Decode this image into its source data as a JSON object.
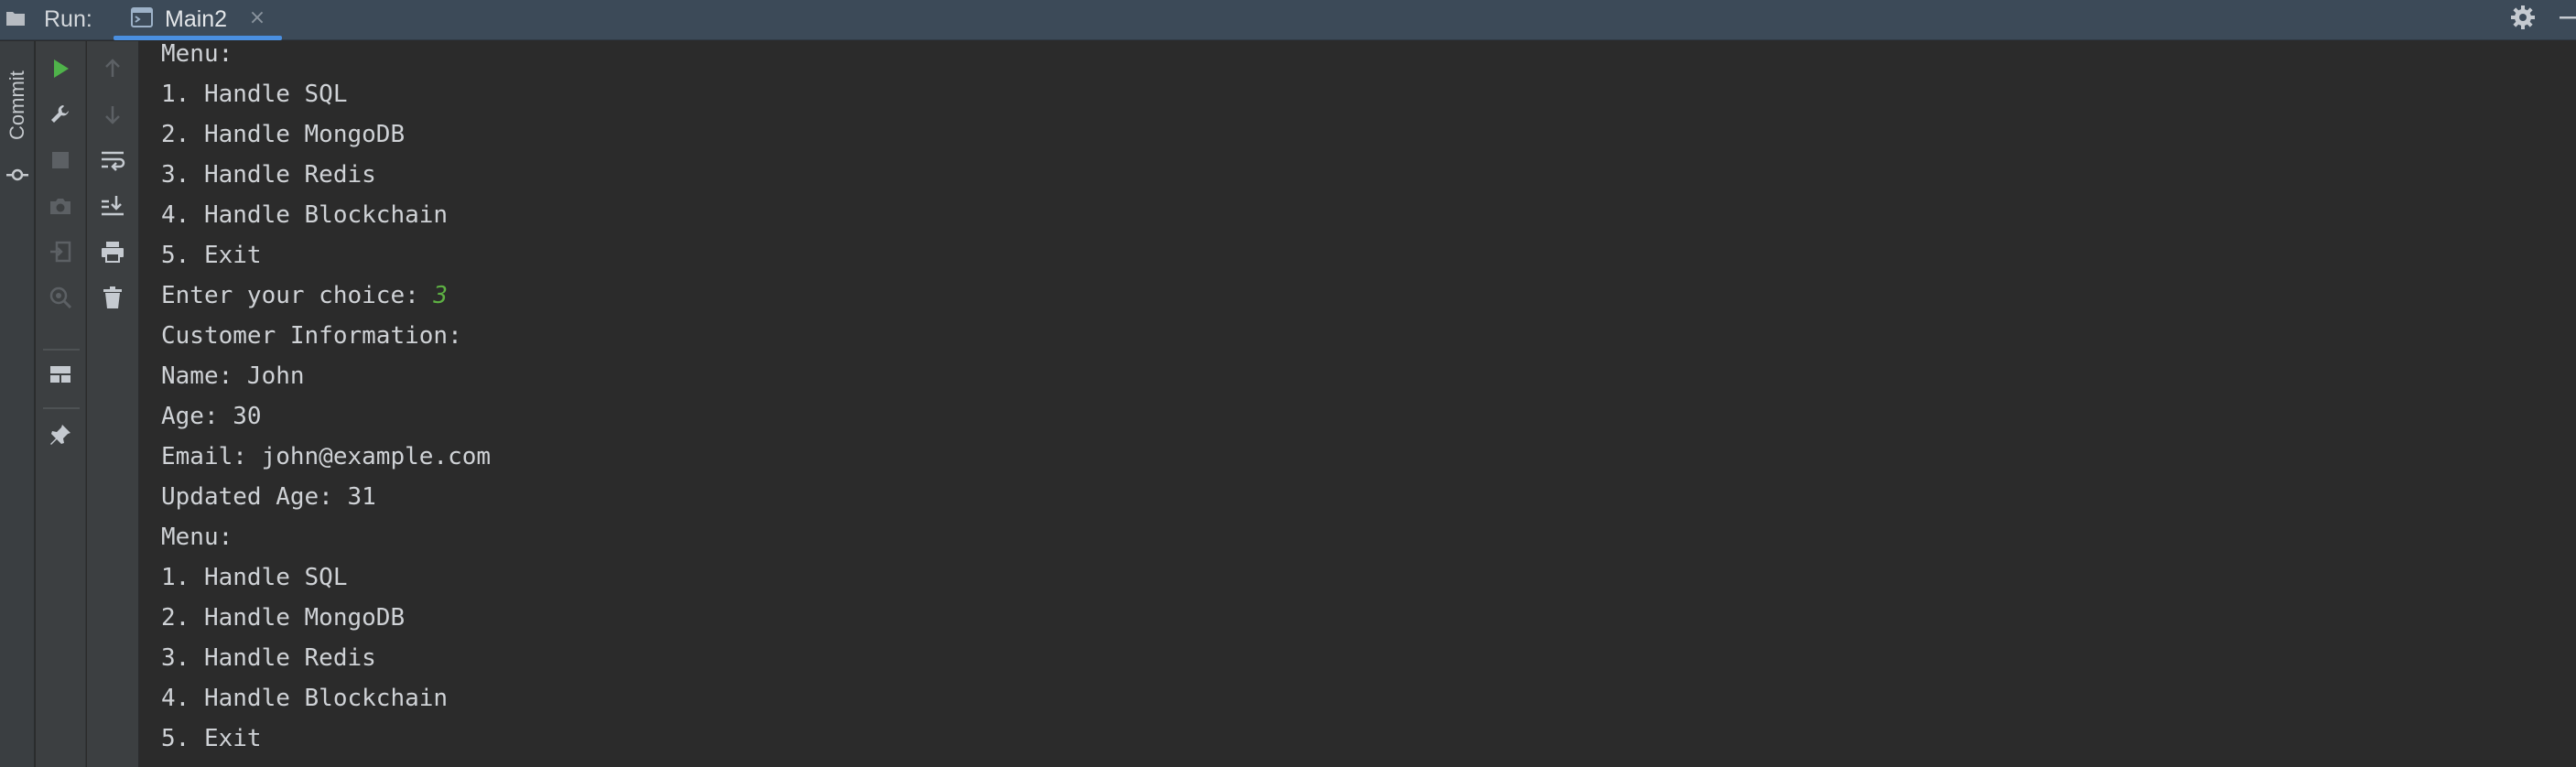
{
  "header": {
    "run_label": "Run:",
    "tab_label": "Main2",
    "tab_close_glyph": "×",
    "accent_color": "#4a8fe0"
  },
  "left_strip": {
    "commit_label": "Commit"
  },
  "toolbar": {
    "column_one": [
      "run-icon",
      "wrench-icon",
      "stop-icon",
      "camera-icon",
      "exit-icon",
      "settings-debug-icon",
      "layout-icon",
      "pin-icon"
    ],
    "column_two": [
      "arrow-up-icon",
      "arrow-down-icon",
      "soft-wrap-icon",
      "scroll-to-end-icon",
      "print-icon",
      "trash-icon"
    ]
  },
  "console": {
    "input_color": "#5db043",
    "lines": [
      {
        "text": "Menu:"
      },
      {
        "text": "1. Handle SQL"
      },
      {
        "text": "2. Handle MongoDB"
      },
      {
        "text": "3. Handle Redis"
      },
      {
        "text": "4. Handle Blockchain"
      },
      {
        "text": "5. Exit"
      },
      {
        "text": "Enter your choice: ",
        "input": "3"
      },
      {
        "text": "Customer Information:"
      },
      {
        "text": "Name: John"
      },
      {
        "text": "Age: 30"
      },
      {
        "text": "Email: john@example.com"
      },
      {
        "text": "Updated Age: 31"
      },
      {
        "text": "Menu:"
      },
      {
        "text": "1. Handle SQL"
      },
      {
        "text": "2. Handle MongoDB"
      },
      {
        "text": "3. Handle Redis"
      },
      {
        "text": "4. Handle Blockchain"
      },
      {
        "text": "5. Exit"
      }
    ]
  }
}
